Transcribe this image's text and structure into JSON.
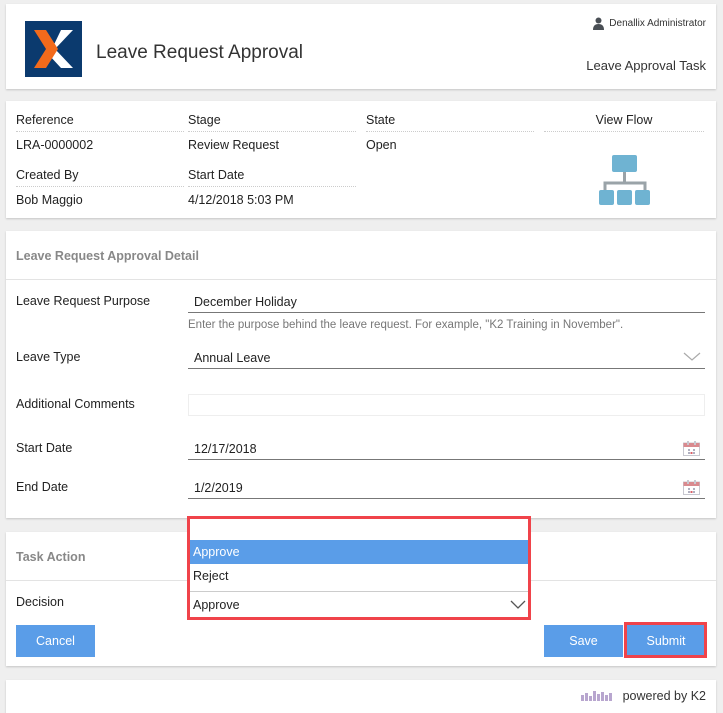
{
  "header": {
    "title": "Leave Request Approval",
    "user_name": "Denallix Administrator",
    "task_name": "Leave Approval Task",
    "logo_icon": "k2-logo-icon",
    "user_icon": "user-icon"
  },
  "info": {
    "reference_label": "Reference",
    "reference_value": "LRA-0000002",
    "stage_label": "Stage",
    "stage_value": "Review Request",
    "state_label": "State",
    "state_value": "Open",
    "created_by_label": "Created By",
    "created_by_value": "Bob Maggio",
    "start_date_label": "Start Date",
    "start_date_value": "4/12/2018 5:03 PM",
    "view_flow_label": "View Flow",
    "view_flow_icon": "workflow-hierarchy-icon"
  },
  "detail": {
    "section_title": "Leave Request Approval Detail",
    "purpose_label": "Leave Request Purpose",
    "purpose_value": "December Holiday",
    "purpose_hint": "Enter the purpose behind the leave request. For example, \"K2 Training in November\".",
    "leave_type_label": "Leave Type",
    "leave_type_value": "Annual Leave",
    "comments_label": "Additional Comments",
    "comments_value": "",
    "start_date_label": "Start Date",
    "start_date_value": "12/17/2018",
    "end_date_label": "End Date",
    "end_date_value": "1/2/2019"
  },
  "task_action": {
    "section_title": "Task Action",
    "decision_label": "Decision",
    "decision_value": "Approve",
    "decision_options": [
      {
        "label": "Approve",
        "selected": true
      },
      {
        "label": "Reject",
        "selected": false
      }
    ],
    "cancel_label": "Cancel",
    "save_label": "Save",
    "submit_label": "Submit"
  },
  "footer": {
    "powered_by": "powered by K2"
  },
  "colors": {
    "accent": "#5a9de8",
    "highlight": "#f0434a",
    "logo_bg": "#0b3a6e",
    "logo_orange": "#f26a1b"
  }
}
